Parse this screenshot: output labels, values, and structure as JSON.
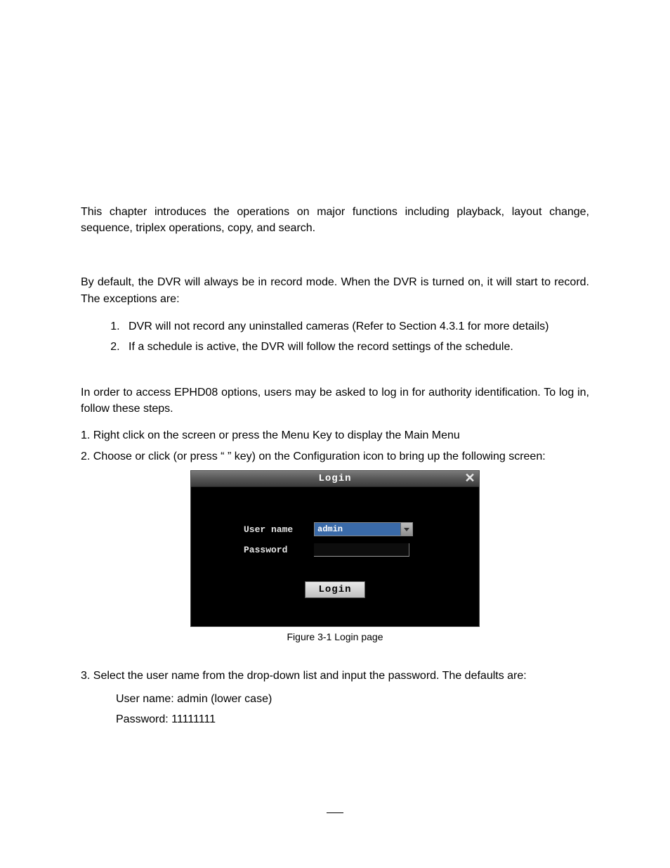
{
  "intro": "This chapter introduces the operations on major functions including playback, layout change, sequence, triplex operations, copy, and search.",
  "recordIntro": "By default, the DVR will always be in record mode. When the DVR is turned on, it will start to record. The exceptions are:",
  "exceptions": [
    "DVR will not record any uninstalled cameras (Refer to Section 4.3.1 for more details)",
    "If a schedule is active, the DVR will follow the record settings of the schedule."
  ],
  "loginIntro": "In order to access EPHD08 options, users may be asked to log in for authority identification. To log in, follow these steps.",
  "step1": "1. Right click on the screen or press the Menu Key to display the Main Menu",
  "step2": "2. Choose or click (or press “        ” key) on the Configuration icon to bring up the following screen:",
  "loginWindow": {
    "title": "Login",
    "userLabel": "User name",
    "userValue": "admin",
    "passLabel": "Password",
    "button": "Login"
  },
  "caption": "Figure 3-1 Login page",
  "step3": "3. Select the user name from the drop-down list and input the password. The defaults are:",
  "defaults": {
    "user": "User name: admin (lower case)",
    "pass": "Password: 11111111"
  }
}
